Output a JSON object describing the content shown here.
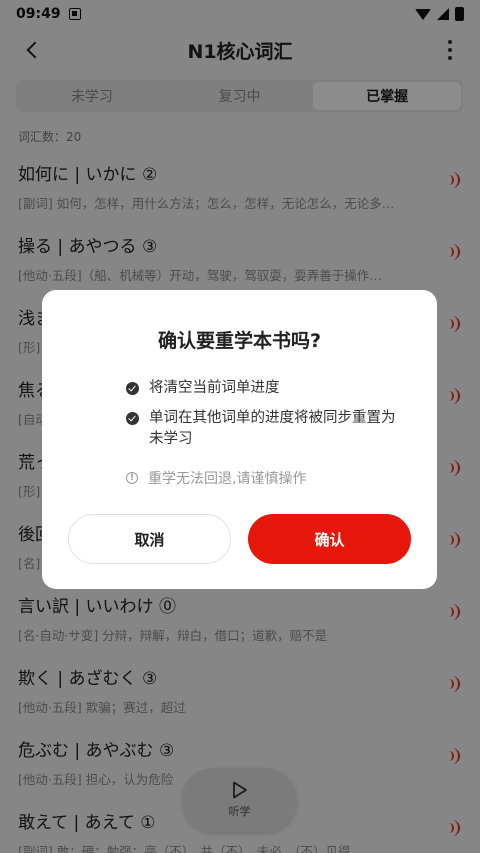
{
  "status_bar": {
    "time": "09:49"
  },
  "header": {
    "title": "N1核心词汇"
  },
  "tabs": [
    {
      "label": "未学习"
    },
    {
      "label": "复习中"
    },
    {
      "label": "已掌握"
    }
  ],
  "vocab_count": "词汇数：20",
  "words": [
    {
      "word": "如何に | いかに ②",
      "definition": "[副词] 如何，怎样，用什么方法；怎么，怎样，无论怎么，无论多…"
    },
    {
      "word": "操る | あやつる ③",
      "definition": "[他动·五段]（船、机械等）开动，驾驶，驾驭耍，耍弄善于操作…"
    },
    {
      "word": "浅ま",
      "definition": "[形]"
    },
    {
      "word": "焦る",
      "definition": "[自动"
    },
    {
      "word": "荒っ",
      "definition": "[形]"
    },
    {
      "word": "後回",
      "definition": "[名]"
    },
    {
      "word": "言い訳 | いいわけ ⓪",
      "definition": "[名·自动·サ变] 分辩，辩解，辩白，借口；道歉，赔不是"
    },
    {
      "word": "欺く | あざむく ③",
      "definition": "[他动·五段] 欺骗；赛过，超过"
    },
    {
      "word": "危ぶむ | あやぶむ ③",
      "definition": "[他动·五段] 担心，认为危险"
    },
    {
      "word": "敢えて | あえて ①",
      "definition": "[副词] 敢；硬；勉强；毫（不），并（不），未必，（不）见得"
    }
  ],
  "listen_button": {
    "label": "听学"
  },
  "dialog": {
    "title": "确认要重学本书吗?",
    "bullets": [
      "将清空当前词单进度",
      "单词在其他词单的进度将被同步重置为未学习"
    ],
    "warning": "重学无法回退,请谨慎操作",
    "cancel_label": "取消",
    "confirm_label": "确认"
  }
}
